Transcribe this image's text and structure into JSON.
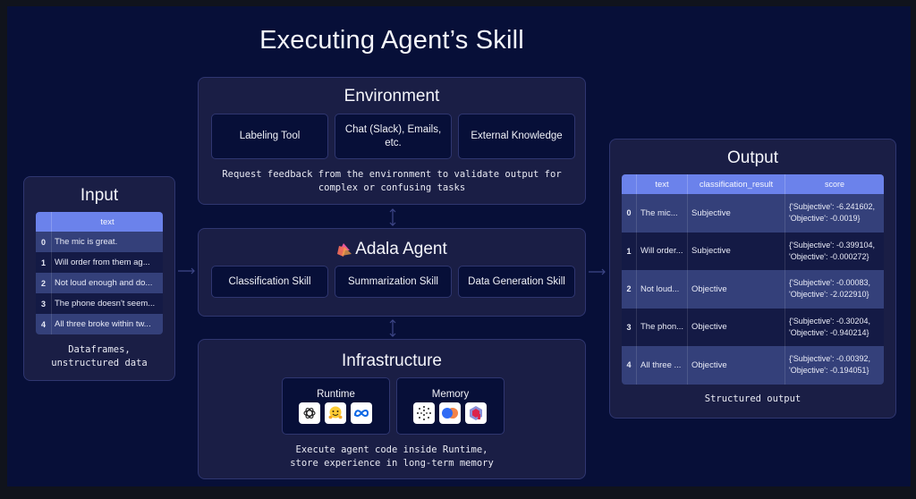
{
  "title": "Executing Agent’s Skill",
  "input": {
    "title": "Input",
    "table": {
      "columns": [
        "",
        "text"
      ],
      "rows": [
        {
          "index": "0",
          "text": "The mic is great."
        },
        {
          "index": "1",
          "text": "Will order from them ag..."
        },
        {
          "index": "2",
          "text": "Not loud enough and do..."
        },
        {
          "index": "3",
          "text": "The phone doesn't seem..."
        },
        {
          "index": "4",
          "text": "All three broke within tw..."
        }
      ]
    },
    "caption_line1": "Dataframes,",
    "caption_line2": "unstructured data"
  },
  "environment": {
    "title": "Environment",
    "items": [
      "Labeling Tool",
      "Chat (Slack), Emails, etc.",
      "External Knowledge"
    ],
    "caption_line1": "Request feedback from the environment to validate output for",
    "caption_line2": "complex or confusing tasks"
  },
  "agent": {
    "title": "Adala Agent",
    "logo_icon": "adala-logo-icon",
    "skills": [
      "Classification Skill",
      "Summarization Skill",
      "Data Generation Skill"
    ]
  },
  "infrastructure": {
    "title": "Infrastructure",
    "runtime": {
      "label": "Runtime",
      "icons": [
        "openai-icon",
        "huggingface-icon",
        "meta-icon"
      ]
    },
    "memory": {
      "label": "Memory",
      "icons": [
        "openai-dots-icon",
        "toggle-circles-icon",
        "qdrant-icon"
      ]
    },
    "caption_line1": "Execute agent code inside Runtime,",
    "caption_line2": "store experience in long-term memory"
  },
  "output": {
    "title": "Output",
    "table": {
      "columns": [
        "",
        "text",
        "classification_result",
        "score"
      ],
      "rows": [
        {
          "index": "0",
          "text": "The mic...",
          "classification_result": "Subjective",
          "score_line1": "{'Subjective': -6.241602,",
          "score_line2": "'Objective': -0.0019}"
        },
        {
          "index": "1",
          "text": "Will order...",
          "classification_result": "Subjective",
          "score_line1": "{'Subjective': -0.399104,",
          "score_line2": "'Objective': -0.000272}"
        },
        {
          "index": "2",
          "text": "Not loud...",
          "classification_result": "Objective",
          "score_line1": "{'Subjective': -0.00083,",
          "score_line2": "'Objective': -2.022910}"
        },
        {
          "index": "3",
          "text": "The phon...",
          "classification_result": "Objective",
          "score_line1": "{'Subjective': -0.30204,",
          "score_line2": "'Objective': -0.940214}"
        },
        {
          "index": "4",
          "text": "All three ...",
          "classification_result": "Objective",
          "score_line1": "{'Subjective': -0.00392,",
          "score_line2": "'Objective': -0.194051}"
        }
      ]
    },
    "caption": "Structured output"
  },
  "colors": {
    "background": "#070f38",
    "panel": "#1a1e45",
    "table_header": "#6b82eb",
    "row_light": "#34407a",
    "row_dark": "#141a45"
  }
}
